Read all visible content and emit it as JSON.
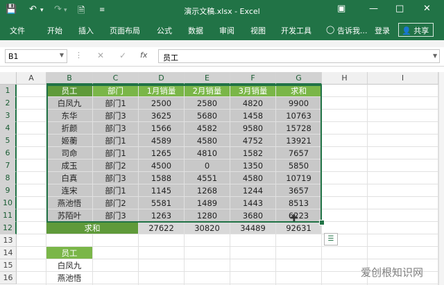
{
  "window": {
    "title": "演示文稿.xlsx - Excel"
  },
  "ribbon": {
    "tabs": [
      "文件",
      "开始",
      "插入",
      "页面布局",
      "公式",
      "数据",
      "审阅",
      "视图",
      "开发工具"
    ],
    "tell_me": "告诉我...",
    "login": "登录",
    "share": "共享"
  },
  "formula_bar": {
    "name_box": "B1",
    "content": "员工"
  },
  "sheet": {
    "columns": [
      "A",
      "B",
      "C",
      "D",
      "E",
      "F",
      "G",
      "H",
      "I"
    ],
    "rows": [
      "1",
      "2",
      "3",
      "4",
      "5",
      "6",
      "7",
      "8",
      "9",
      "10",
      "11",
      "12",
      "13",
      "14",
      "15",
      "16"
    ],
    "table_header": [
      "员工",
      "部门",
      "1月销量",
      "2月销量",
      "3月销量",
      "求和"
    ],
    "table_rows": [
      [
        "白凤九",
        "部门1",
        "2500",
        "2580",
        "4820",
        "9900"
      ],
      [
        "东华",
        "部门3",
        "3625",
        "5680",
        "1458",
        "10763"
      ],
      [
        "折颜",
        "部门3",
        "1566",
        "4582",
        "9580",
        "15728"
      ],
      [
        "姬蘅",
        "部门1",
        "4589",
        "4580",
        "4752",
        "13921"
      ],
      [
        "司命",
        "部门1",
        "1265",
        "4810",
        "1582",
        "7657"
      ],
      [
        "成玉",
        "部门2",
        "4500",
        "0",
        "1350",
        "5850"
      ],
      [
        "白真",
        "部门3",
        "1588",
        "4551",
        "4580",
        "10719"
      ],
      [
        "连宋",
        "部门1",
        "1145",
        "1268",
        "1244",
        "3657"
      ],
      [
        "燕池悟",
        "部门2",
        "5581",
        "1489",
        "1443",
        "8513"
      ],
      [
        "苏陌叶",
        "部门3",
        "1263",
        "1280",
        "3680",
        "6223"
      ]
    ],
    "sum_row": [
      "求和",
      "",
      "27622",
      "30820",
      "34489",
      "92631"
    ],
    "lower_list": [
      "员工",
      "白凤九",
      "燕池悟"
    ]
  },
  "watermark": "爱创根知识网",
  "colors": {
    "brand": "#217346",
    "header_fill": "#7ab648",
    "selection_fill": "#c8c8c8"
  }
}
